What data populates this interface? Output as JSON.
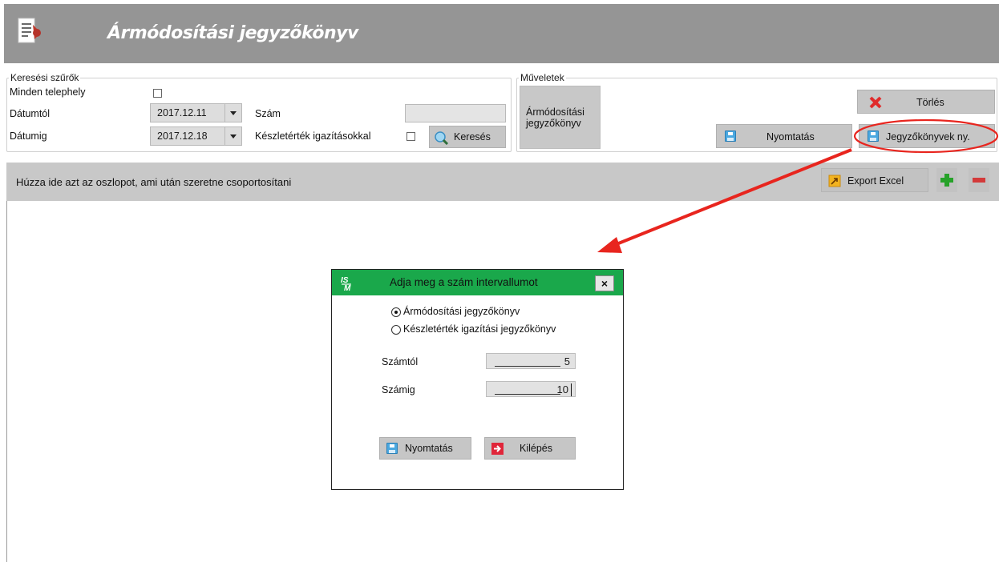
{
  "window": {
    "title": "Ármódosítási jegyzőkönyv"
  },
  "filters": {
    "legend": "Keresési szűrők",
    "all_sites_label": "Minden telephely",
    "date_from_label": "Dátumtól",
    "date_from_value": "2017.12.11",
    "date_to_label": "Dátumig",
    "date_to_value": "2017.12.18",
    "number_label": "Szám",
    "number_value": "",
    "stock_adjust_label": "Készletérték igazításokkal",
    "search_button": "Keresés"
  },
  "operations": {
    "legend": "Műveletek",
    "price_protocol_line1": "Ármódosítási",
    "price_protocol_line2": "jegyzőkönyv",
    "delete_button": "Törlés",
    "print_button": "Nyomtatás",
    "protocols_print_button": "Jegyzőkönyvek ny."
  },
  "grid": {
    "group_hint": "Húzza ide azt az oszlopot, ami után szeretne csoportosítani",
    "export_button": "Export Excel"
  },
  "dialog": {
    "title": "Adja meg a szám intervallumot",
    "logo_text": "IS M",
    "close_label": "×",
    "radio_price": "Ármódosítási jegyzőkönyv",
    "radio_stock": "Készletérték igazítási jegyzőkönyv",
    "from_label": "Számtól",
    "from_value": "5",
    "to_label": "Számig",
    "to_value": "10",
    "print_button": "Nyomtatás",
    "exit_button": "Kilépés"
  },
  "colors": {
    "title_bar": "#959595",
    "dialog_title": "#1aa84b",
    "annotation": "#e8251e"
  },
  "icons": [
    "notepad-icon",
    "dropdown-arrow-icon",
    "magnifier-icon",
    "delete-x-icon",
    "floppy-icon",
    "excel-export-icon",
    "plus-icon",
    "minus-icon",
    "exit-icon",
    "close-icon"
  ]
}
